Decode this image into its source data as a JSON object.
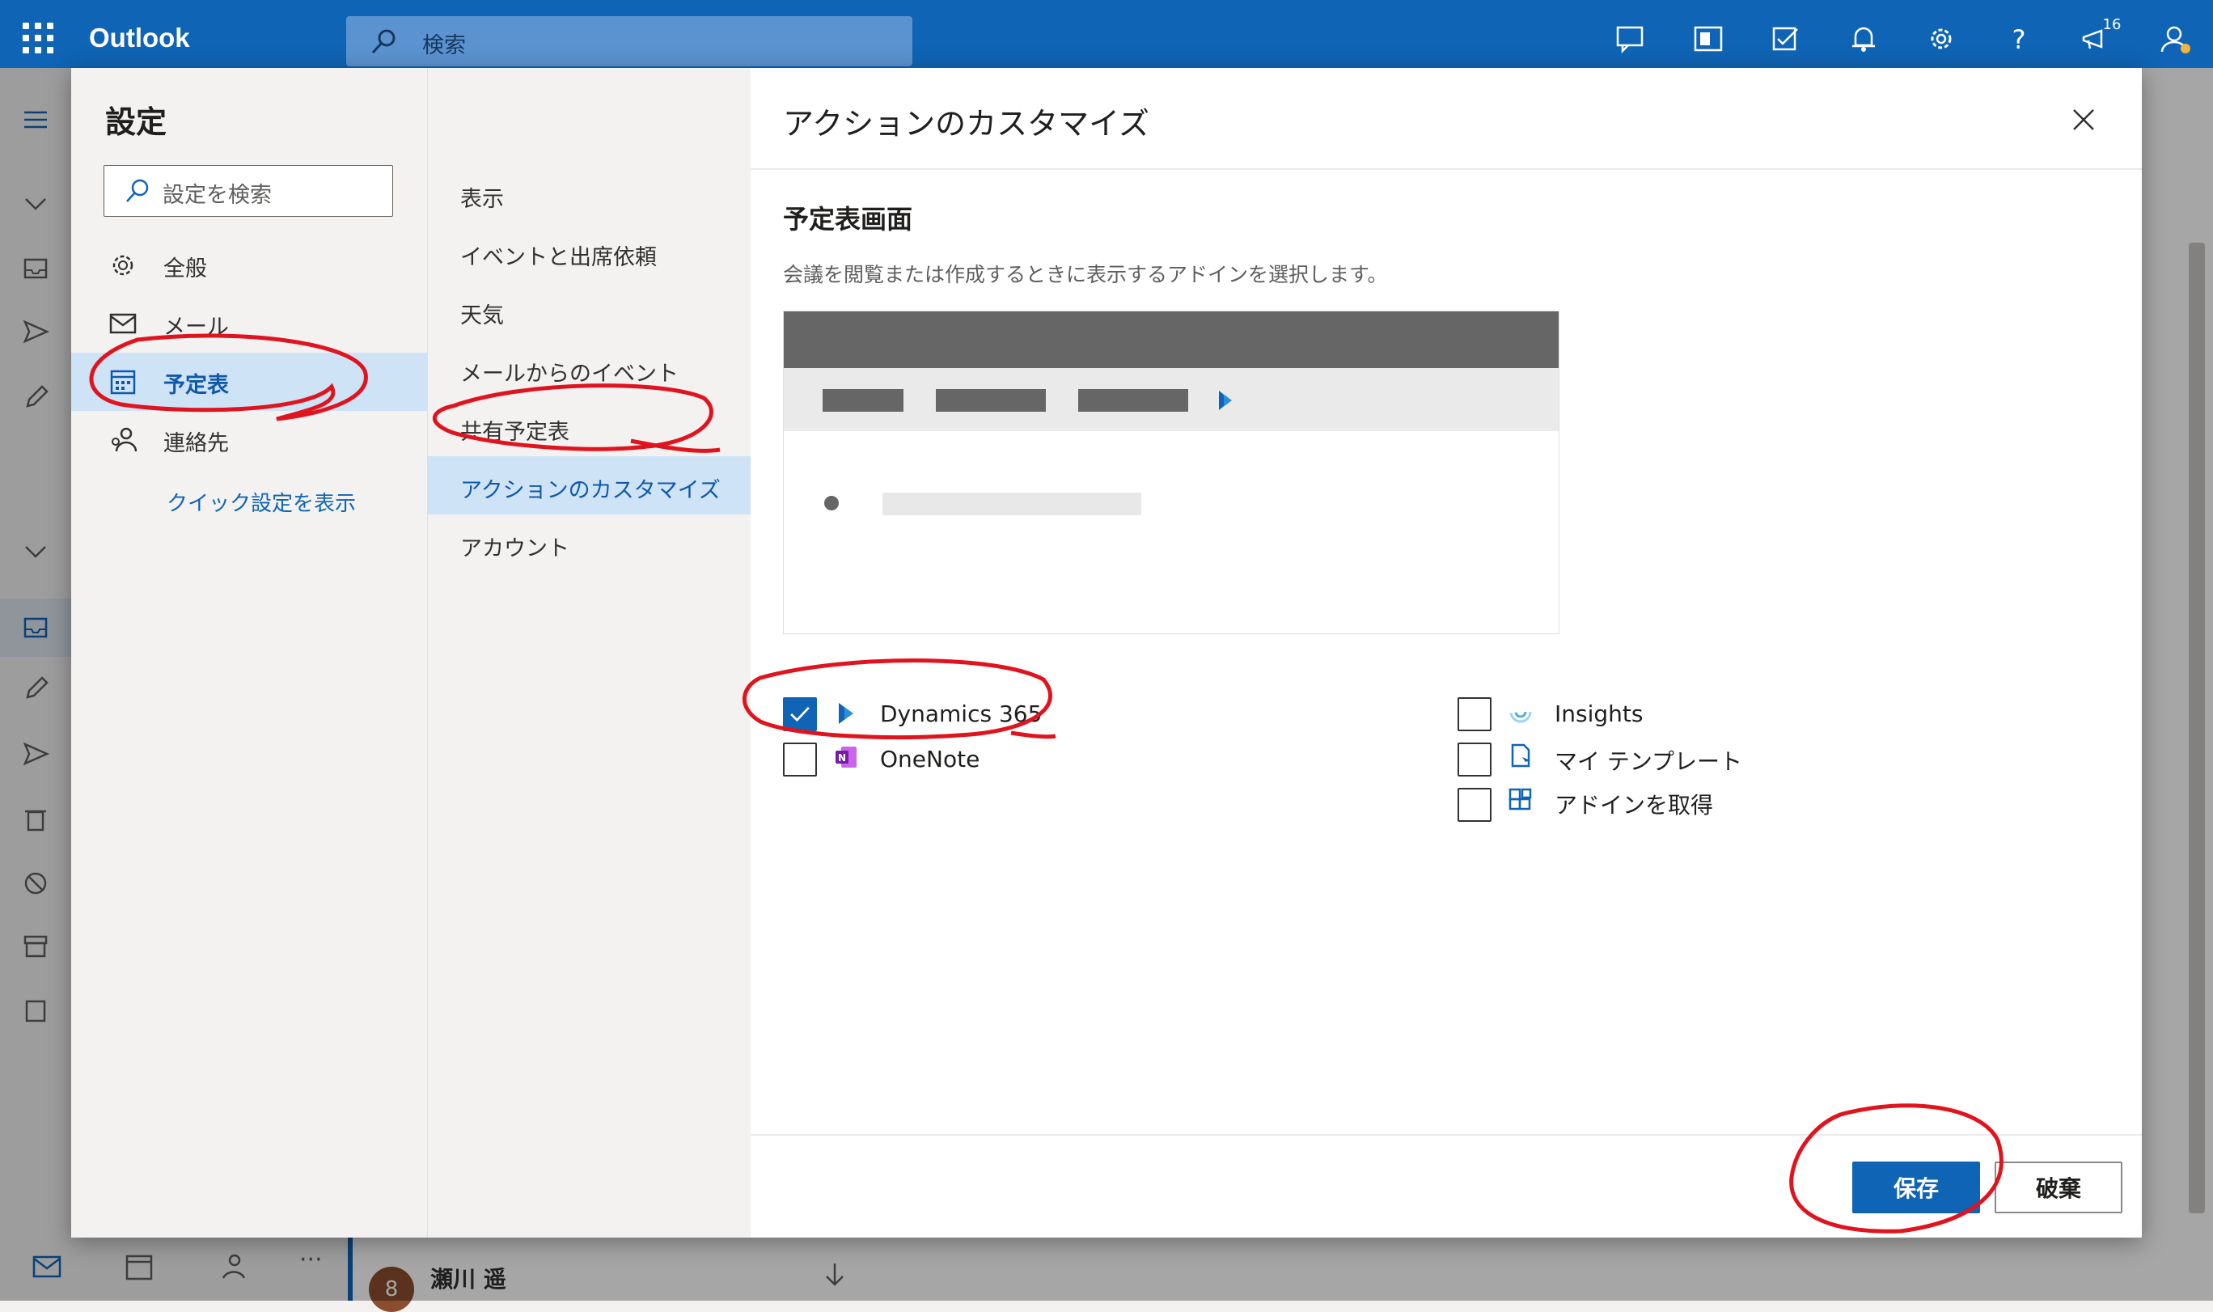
{
  "app": {
    "title": "Outlook",
    "search_placeholder": "検索",
    "notification_count": "16"
  },
  "topbar": {
    "icons": [
      "chat-icon",
      "office-icon",
      "tasks-icon",
      "bell-icon",
      "gear-icon",
      "help-icon",
      "announcement-icon",
      "account-icon"
    ]
  },
  "settings": {
    "title": "設定",
    "search_placeholder": "設定を検索",
    "categories": [
      {
        "label": "全般",
        "icon": "gear-icon"
      },
      {
        "label": "メール",
        "icon": "mail-icon"
      },
      {
        "label": "予定表",
        "icon": "calendar-icon",
        "selected": true
      },
      {
        "label": "連絡先",
        "icon": "people-icon"
      }
    ],
    "quick_settings_link": "クイック設定を表示",
    "subcategories": [
      {
        "label": "表示"
      },
      {
        "label": "イベントと出席依頼"
      },
      {
        "label": "天気"
      },
      {
        "label": "メールからのイベント"
      },
      {
        "label": "共有予定表"
      },
      {
        "label": "アクションのカスタマイズ",
        "selected": true
      },
      {
        "label": "アカウント"
      }
    ]
  },
  "content": {
    "title": "アクションのカスタマイズ",
    "section_title": "予定表画面",
    "section_description": "会議を閲覧または作成するときに表示するアドインを選択します。",
    "addins_left": [
      {
        "label": "Dynamics 365",
        "checked": true,
        "icon": "dynamics-icon"
      },
      {
        "label": "OneNote",
        "checked": false,
        "icon": "onenote-icon"
      }
    ],
    "addins_right": [
      {
        "label": "Insights",
        "checked": false,
        "icon": "insights-icon"
      },
      {
        "label": "マイ テンプレート",
        "checked": false,
        "icon": "template-icon"
      },
      {
        "label": "アドインを取得",
        "checked": false,
        "icon": "addins-grid-icon"
      }
    ],
    "save_label": "保存",
    "discard_label": "破棄"
  },
  "background": {
    "list_user": "瀬川 遥",
    "avatar_initial": "8"
  },
  "colors": {
    "brand": "#0f64b5",
    "selected_nav": "#cfe3f7",
    "annotation": "#e0141e"
  }
}
